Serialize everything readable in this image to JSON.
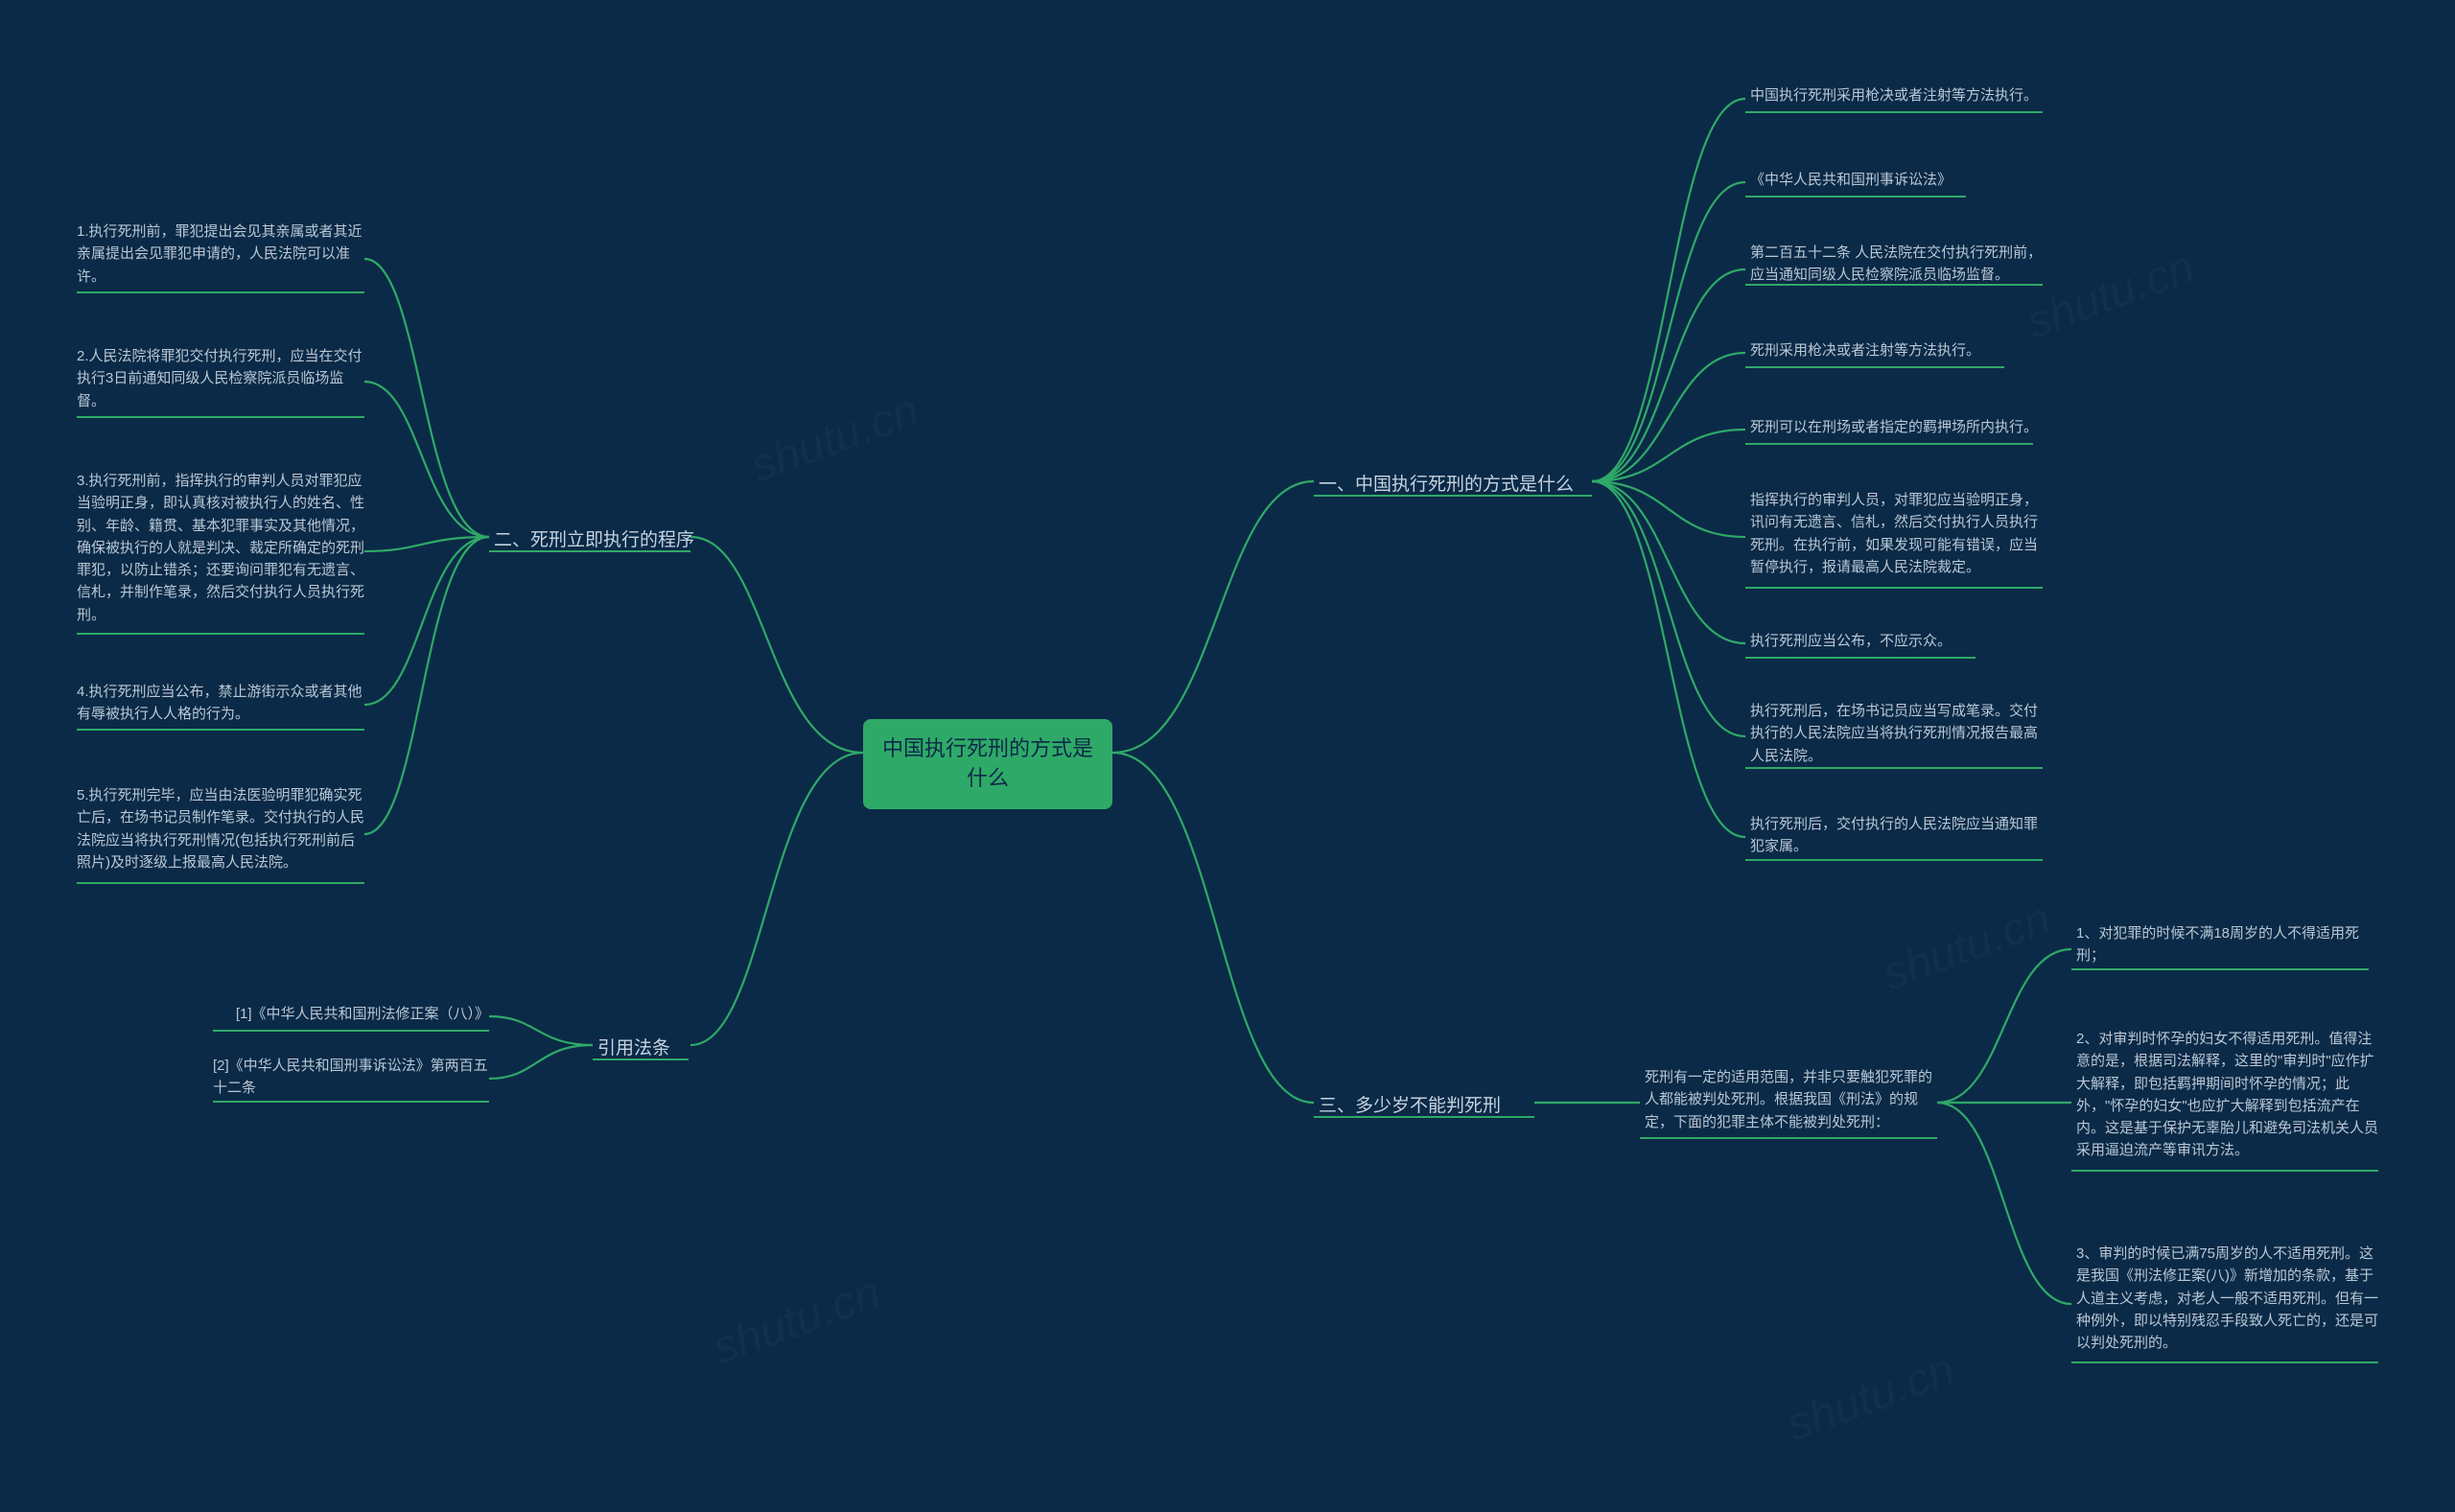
{
  "center": "中国执行死刑的方式是什么",
  "right": {
    "b1": {
      "label": "一、中国执行死刑的方式是什么",
      "items": [
        "中国执行死刑采用枪决或者注射等方法执行。",
        "《中华人民共和国刑事诉讼法》",
        "第二百五十二条 人民法院在交付执行死刑前，应当通知同级人民检察院派员临场监督。",
        "死刑采用枪决或者注射等方法执行。",
        "死刑可以在刑场或者指定的羁押场所内执行。",
        "指挥执行的审判人员，对罪犯应当验明正身，讯问有无遗言、信札，然后交付执行人员执行死刑。在执行前，如果发现可能有错误，应当暂停执行，报请最高人民法院裁定。",
        "执行死刑应当公布，不应示众。",
        "执行死刑后，在场书记员应当写成笔录。交付执行的人民法院应当将执行死刑情况报告最高人民法院。",
        "执行死刑后，交付执行的人民法院应当通知罪犯家属。"
      ]
    },
    "b3": {
      "label": "三、多少岁不能判死刑",
      "sub": "死刑有一定的适用范围，并非只要触犯死罪的人都能被判处死刑。根据我国《刑法》的规定，下面的犯罪主体不能被判处死刑：",
      "items": [
        "1、对犯罪的时候不满18周岁的人不得适用死刑；",
        "2、对审判时怀孕的妇女不得适用死刑。值得注意的是，根据司法解释，这里的\"审判时\"应作扩大解释，即包括羁押期间时怀孕的情况；此外，\"怀孕的妇女\"也应扩大解释到包括流产在内。这是基于保护无辜胎儿和避免司法机关人员采用逼迫流产等审讯方法。",
        "3、审判的时候已满75周岁的人不适用死刑。这是我国《刑法修正案(八)》新增加的条款，基于人道主义考虑，对老人一般不适用死刑。但有一种例外，即以特别残忍手段致人死亡的，还是可以判处死刑的。"
      ]
    }
  },
  "left": {
    "b2": {
      "label": "二、死刑立即执行的程序",
      "items": [
        "1.执行死刑前，罪犯提出会见其亲属或者其近亲属提出会见罪犯申请的，人民法院可以准许。",
        "2.人民法院将罪犯交付执行死刑，应当在交付执行3日前通知同级人民检察院派员临场监督。",
        "3.执行死刑前，指挥执行的审判人员对罪犯应当验明正身，即认真核对被执行人的姓名、性别、年龄、籍贯、基本犯罪事实及其他情况，确保被执行的人就是判决、裁定所确定的死刑罪犯，以防止错杀；还要询问罪犯有无遗言、信札，并制作笔录，然后交付执行人员执行死刑。",
        "4.执行死刑应当公布，禁止游街示众或者其他有辱被执行人人格的行为。",
        "5.执行死刑完毕，应当由法医验明罪犯确实死亡后，在场书记员制作笔录。交付执行的人民法院应当将执行死刑情况(包括执行死刑前后照片)及时逐级上报最高人民法院。"
      ]
    },
    "cite": {
      "label": "引用法条",
      "items": [
        "[1]《中华人民共和国刑法修正案（八）》",
        "[2]《中华人民共和国刑事诉讼法》第两百五十二条"
      ]
    }
  }
}
